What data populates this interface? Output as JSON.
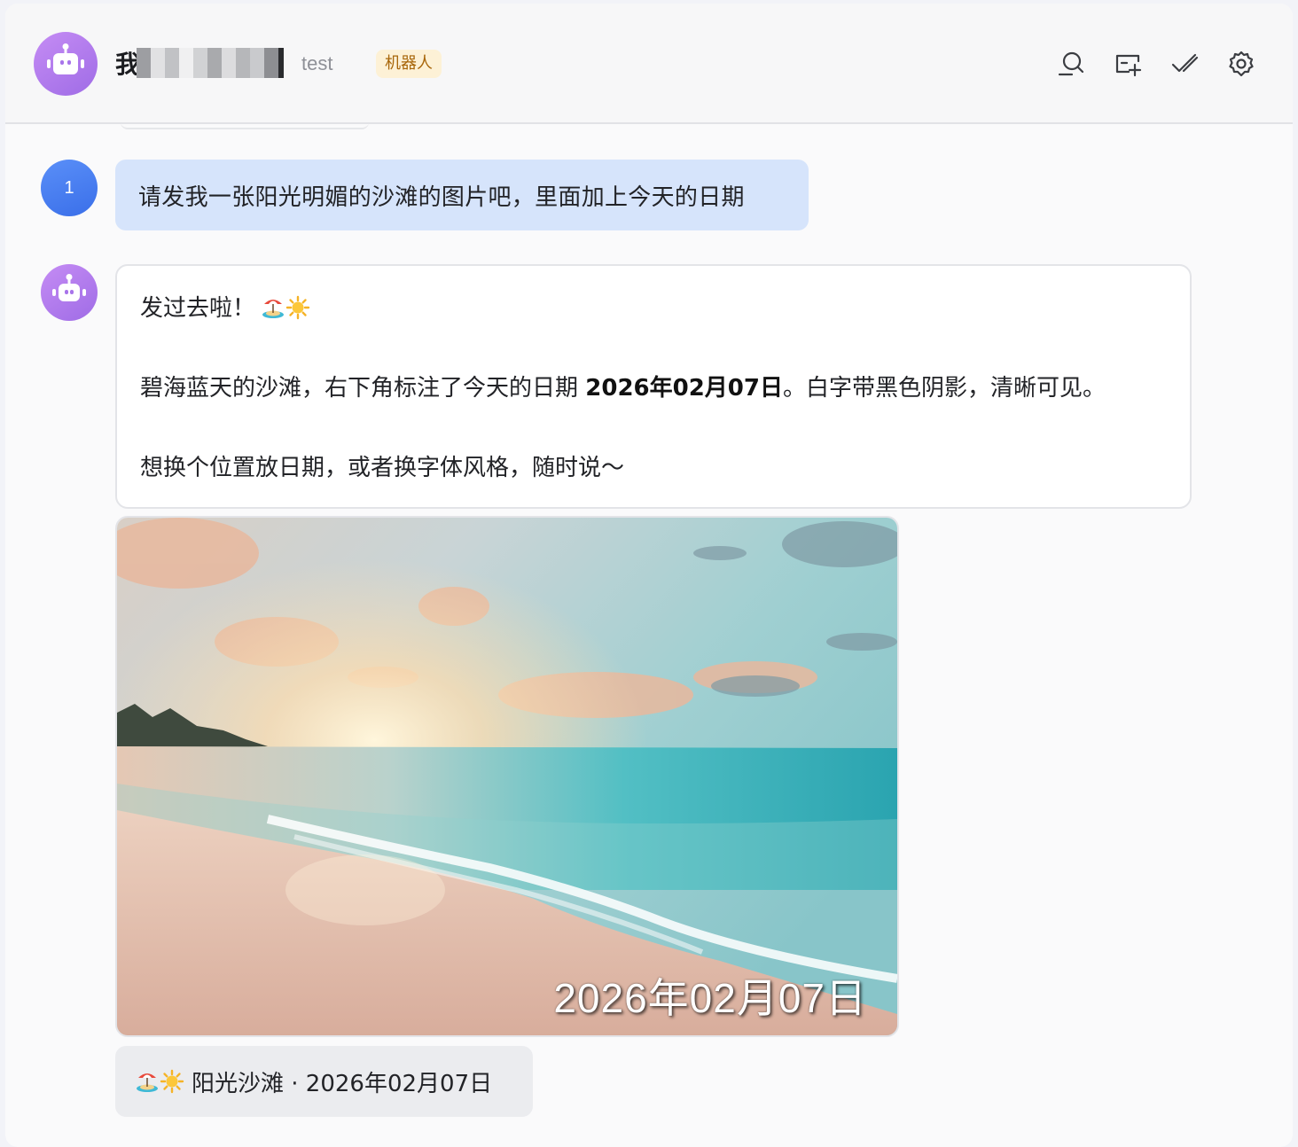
{
  "header": {
    "name_visible_char": "我",
    "subname": "test",
    "badge": "机器人",
    "icons": [
      "search-chat-icon",
      "new-tab-icon",
      "mark-read-icon",
      "settings-gear-icon"
    ]
  },
  "messages": {
    "user": {
      "avatar_label": "1",
      "text": "请发我一张阳光明媚的沙滩的图片吧，里面加上今天的日期"
    },
    "bot": {
      "line1": "发过去啦！",
      "line2_prefix": "碧海蓝天的沙滩，右下角标注了今天的日期 ",
      "line2_bold": "2026年02月07日",
      "line2_suffix": "。白字带黑色阴影，清晰可见。",
      "line3": "想换个位置放日期，或者换字体风格，随时说～"
    },
    "image": {
      "overlay_date": "2026年02月07日"
    },
    "caption": {
      "text": "阳光沙滩 · 2026年02月07日"
    }
  },
  "colors": {
    "bot_avatar": "#a874ea",
    "user_avatar": "#3a6fe9",
    "user_bubble": "#d6e4fb",
    "badge_bg": "#fdf1d6",
    "badge_text": "#a8660a"
  }
}
